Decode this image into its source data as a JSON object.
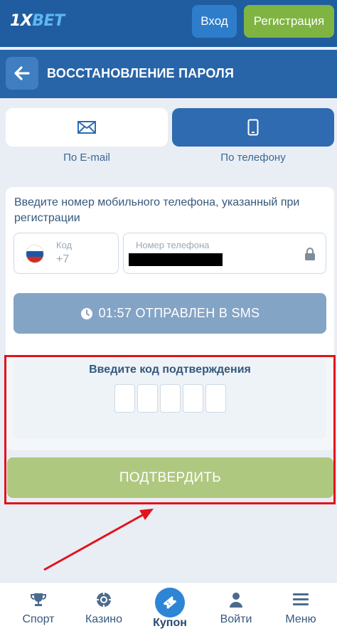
{
  "header": {
    "logo_prefix": "1X",
    "logo_suffix": "BET",
    "login_label": "Вход",
    "register_label": "Регистрация",
    "login_color": "#2e7dcb",
    "register_color": "#7fb442"
  },
  "title_bar": {
    "back_icon": "arrow-left-icon",
    "title": "ВОССТАНОВЛЕНИЕ ПАРОЛЯ"
  },
  "tabs": [
    {
      "label": "По E-mail",
      "icon": "envelope-icon",
      "selected": false
    },
    {
      "label": "По телефону",
      "icon": "mobile-phone-icon",
      "selected": true
    }
  ],
  "form": {
    "instruction": "Введите номер мобильного телефона, указанный при регистрации",
    "code_field": {
      "label": "Код",
      "value": "+7",
      "flag": "russia-flag"
    },
    "phone_field": {
      "label": "Номер телефона",
      "value": "redacted",
      "icon": "lock-icon"
    },
    "sms_button": {
      "icon": "clock-icon",
      "label": "01:57 ОТПРАВЛЕН В SMS"
    },
    "code_entry": {
      "title": "Введите код подтверждения",
      "digit_count": 5,
      "digits": [
        "",
        "",
        "",
        "",
        ""
      ]
    },
    "confirm_button": "ПОДТВЕРДИТЬ"
  },
  "annotation": {
    "color": "#e3121b"
  },
  "bottom_nav": [
    {
      "label": "Спорт",
      "icon": "trophy-icon"
    },
    {
      "label": "Казино",
      "icon": "casino-chip-icon"
    },
    {
      "label": "Купон",
      "icon": "ticket-icon",
      "active": true
    },
    {
      "label": "Войти",
      "icon": "user-icon"
    },
    {
      "label": "Меню",
      "icon": "hamburger-menu-icon"
    }
  ]
}
